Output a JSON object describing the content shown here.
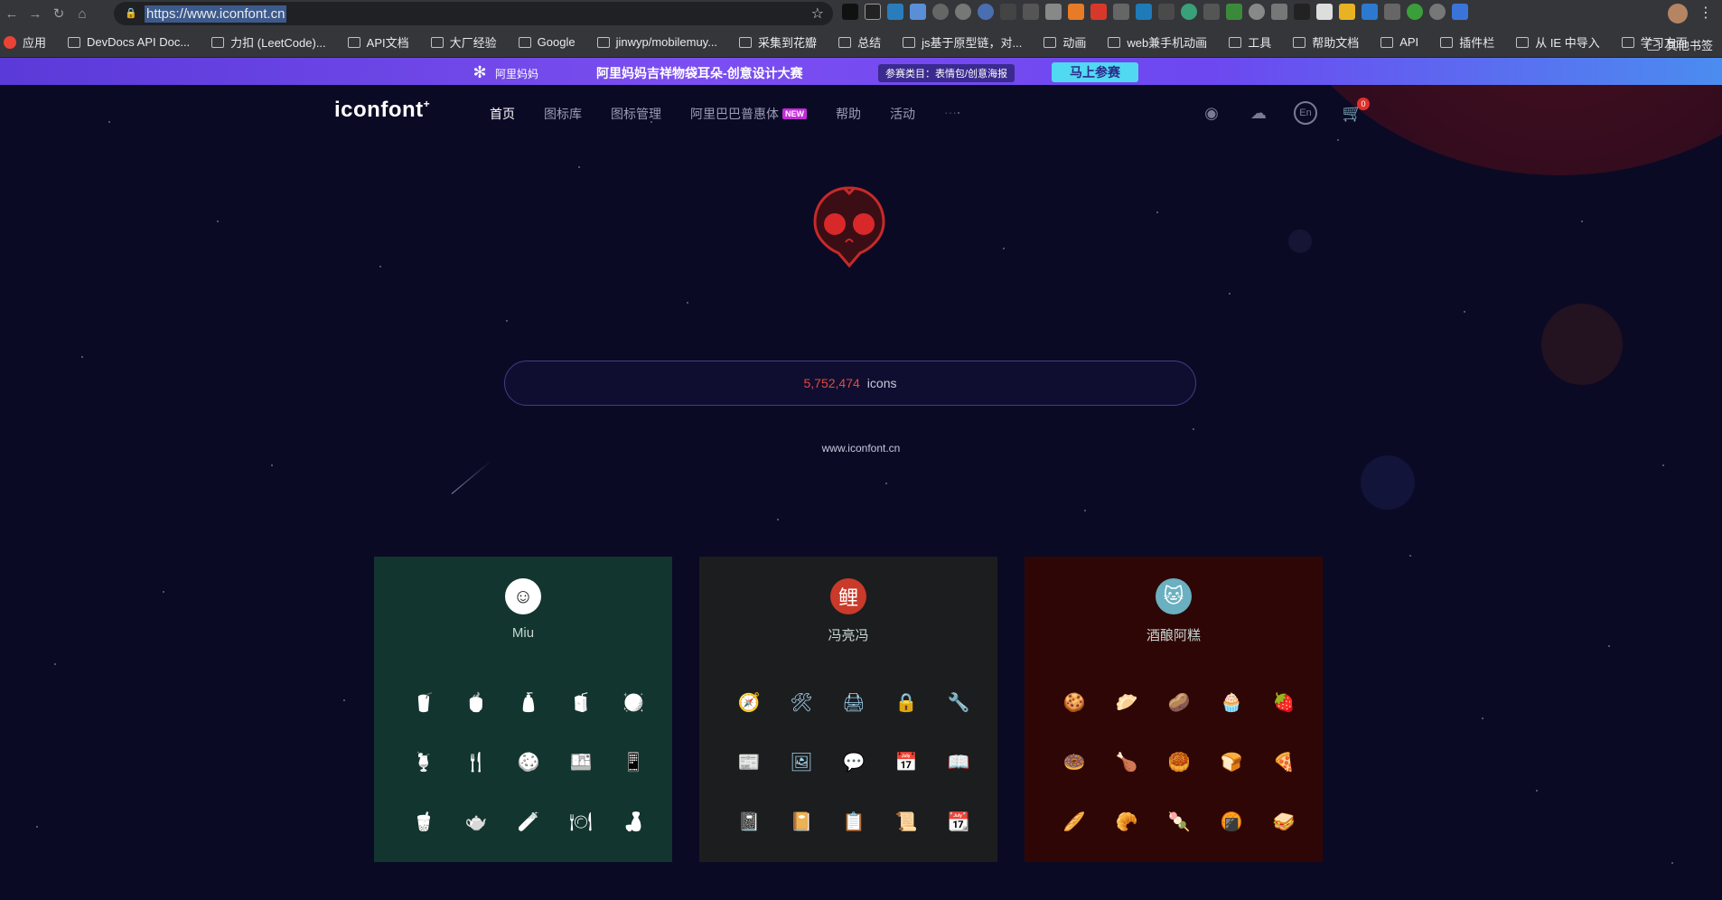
{
  "browser": {
    "url": "https://www.iconfont.cn",
    "bookmarks": [
      {
        "label": "应用"
      },
      {
        "label": "DevDocs API Doc..."
      },
      {
        "label": "力扣 (LeetCode)..."
      },
      {
        "label": "API文档"
      },
      {
        "label": "大厂经验"
      },
      {
        "label": "Google"
      },
      {
        "label": "jinwyp/mobilemuy..."
      },
      {
        "label": "采集到花瓣"
      },
      {
        "label": "总结"
      },
      {
        "label": "js基于原型链，对..."
      },
      {
        "label": "动画"
      },
      {
        "label": "web兼手机动画"
      },
      {
        "label": "工具"
      },
      {
        "label": "帮助文档"
      },
      {
        "label": "API"
      },
      {
        "label": "插件栏"
      },
      {
        "label": "从 IE 中导入"
      },
      {
        "label": "学习方面"
      }
    ],
    "other_bookmarks": "其他书签"
  },
  "banner": {
    "logo": "阿里妈妈",
    "title": "阿里妈妈吉祥物袋耳朵-创意设计大赛",
    "badge": "参赛类目：表情包/创意海报",
    "button": "马上参赛"
  },
  "header": {
    "logo": "iconfont",
    "nav": [
      "首页",
      "图标库",
      "图标管理",
      "阿里巴巴普惠体",
      "帮助",
      "活动"
    ],
    "new_badge": "NEW",
    "lang": "En",
    "cart_count": "0"
  },
  "hero": {
    "icon_count": "5,752,474",
    "icon_unit": "icons",
    "site": "www.iconfont.cn"
  },
  "cards": [
    {
      "name": "Miu",
      "bg": "#12352f",
      "avatar_bg": "#ffffff",
      "icons": [
        "🥤",
        "🍵",
        "🧴",
        "🧃",
        "🪩",
        "🍹",
        "🍴",
        "🍪",
        "🍱",
        "📱",
        "🧋",
        "🫖",
        "🧪",
        "🍽",
        "🍶"
      ],
      "icon_color": "#dfe9e5"
    },
    {
      "name": "冯亮冯",
      "bg": "#1c1d1e",
      "avatar_bg": "#c93a2a",
      "icons": [
        "🧭",
        "🛠",
        "🖨",
        "🔒",
        "🔧",
        "📰",
        "🖼",
        "💬",
        "📅",
        "📖",
        "📓",
        "📔",
        "📋",
        "📜",
        "📆"
      ],
      "icon_color": "#9fd3f0"
    },
    {
      "name": "酒酿阿糕",
      "bg": "#2f0606",
      "avatar_bg": "#6ab0c0",
      "icons": [
        "🍪",
        "🥟",
        "🥔",
        "🧁",
        "🍓",
        "🍩",
        "🍗",
        "🥮",
        "🍞",
        "🍕",
        "🥖",
        "🥐",
        "🍡",
        "🍘",
        "🥪"
      ],
      "icon_color": "#f5d1a0"
    }
  ]
}
